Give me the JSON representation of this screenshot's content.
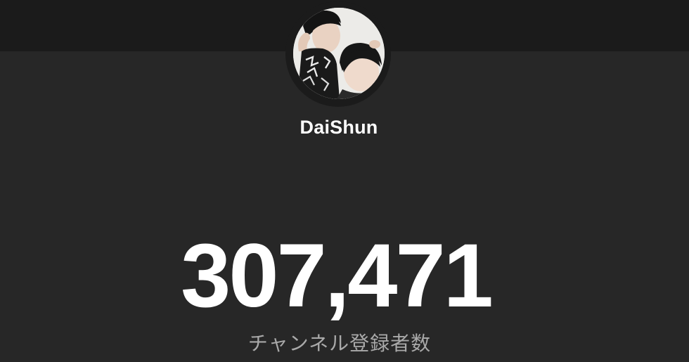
{
  "channel": {
    "name": "DaiShun",
    "avatar_icon": "channel-avatar-photo"
  },
  "stats": {
    "subscriber_count": "307,471",
    "subscriber_label": "チャンネル登録者数"
  },
  "colors": {
    "background": "#272727",
    "top_band": "#1b1b1b",
    "primary_text": "#ffffff",
    "secondary_text": "#a9a9a9"
  }
}
